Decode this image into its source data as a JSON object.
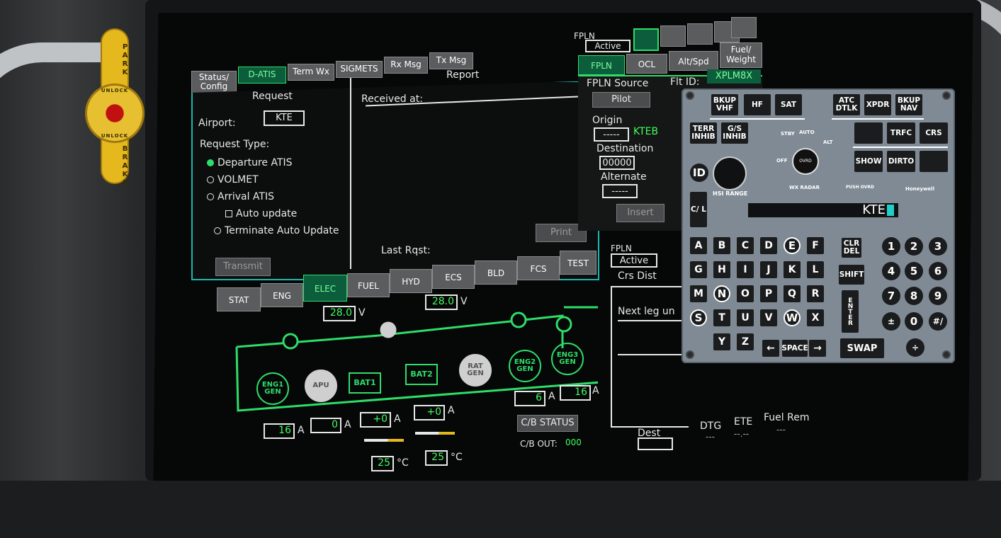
{
  "park_brake": {
    "top": "PARK",
    "unlock1": "UNLOCK",
    "unlock2": "UNLOCK",
    "bottom": "BRAKE"
  },
  "datalink": {
    "tabs": [
      "Status/ Config",
      "D-ATIS",
      "Term Wx",
      "SIGMETS",
      "Rx Msg",
      "Tx Msg"
    ],
    "request_title": "Request",
    "report_title": "Report",
    "airport_label": "Airport:",
    "airport_value": "KTE",
    "request_type_label": "Request Type:",
    "options": [
      "Departure ATIS",
      "VOLMET",
      "Arrival ATIS",
      "Auto update",
      "Terminate Auto Update"
    ],
    "received_label": "Received at:",
    "last_rqst_label": "Last Rqst:",
    "transmit": "Transmit",
    "print": "Print"
  },
  "fpln": {
    "header_label": "FPLN",
    "header_value": "Active",
    "tabs": [
      "FPLN",
      "OCL",
      "Alt/Spd",
      "Fuel/ Weight"
    ],
    "source_label": "FPLN Source",
    "source_value": "Pilot",
    "origin_label": "Origin",
    "origin_box": "-----",
    "origin_value": "KTEB",
    "dest_label": "Destination",
    "dest_box": "00000",
    "alt_label": "Alternate",
    "alt_box": "-----",
    "insert": "Insert",
    "flt_id_label": "Flt ID:",
    "flt_id_value": "XPLM8X"
  },
  "fpln2": {
    "header_label": "FPLN",
    "header_value": "Active",
    "cols": "Crs Dist",
    "next_leg": "Next leg un",
    "dest": "Dest",
    "dtg": "DTG",
    "ete": "ETE",
    "fuel": "Fuel Rem",
    "dtg_val": "---",
    "ete_val": "--.--",
    "fuel_val": "---"
  },
  "synoptic": {
    "tabs": [
      "STAT",
      "ENG",
      "ELEC",
      "FUEL",
      "HYD",
      "ECS",
      "BLD",
      "FCS",
      "TEST"
    ],
    "volt_left": "28.0",
    "volt_right": "28.0",
    "v_unit": "V",
    "sources": [
      "ENG1 GEN",
      "APU",
      "BAT1",
      "BAT2",
      "RAT GEN",
      "ENG2 GEN",
      "ENG3 GEN"
    ],
    "amps": [
      {
        "v": "16",
        "u": "A"
      },
      {
        "v": "0",
        "u": "A"
      },
      {
        "v": "+0",
        "u": "A"
      },
      {
        "v": "+0",
        "u": "A"
      },
      {
        "v": "6",
        "u": "A"
      },
      {
        "v": "16",
        "u": "A"
      }
    ],
    "temps": [
      {
        "v": "25",
        "u": "°C"
      },
      {
        "v": "25",
        "u": "°C"
      }
    ],
    "cb_status": "C/B STATUS",
    "cb_out_label": "C/B OUT:",
    "cb_out_value": "000"
  },
  "keypad": {
    "top": [
      "BKUP VHF",
      "HF",
      "SAT",
      "ATC DTLK",
      "XPDR",
      "BKUP NAV"
    ],
    "row2": [
      "TERR INHIB",
      "G/S INHIB",
      "TRFC",
      "CRS"
    ],
    "row3": [
      "SHOW",
      "DIRTO"
    ],
    "id": "ID",
    "hsi_range": "HSI RANGE",
    "cl": "C/ L",
    "knob": {
      "stby": "STBY",
      "auto": "AUTO",
      "alt": "ALT",
      "off": "OFF",
      "ovrd": "OVRD"
    },
    "wx_radar": "WX RADAR",
    "push_ovrd": "PUSH OVRD",
    "brand": "Honeywell",
    "scratch": "KTE",
    "letters": [
      "A",
      "B",
      "C",
      "D",
      "E",
      "F",
      "G",
      "H",
      "I",
      "J",
      "K",
      "L",
      "M",
      "N",
      "O",
      "P",
      "Q",
      "R",
      "S",
      "T",
      "U",
      "V",
      "W",
      "X",
      "Y",
      "Z"
    ],
    "clr": "CLR DEL",
    "shift": "SHIFT",
    "enter": "ENTER",
    "space": "SPACE",
    "swap": "SWAP",
    "left_arrow": "←",
    "right_arrow": "→",
    "digits": [
      "1",
      "2",
      "3",
      "4",
      "5",
      "6",
      "7",
      "8",
      "9",
      "0"
    ],
    "dot": "±",
    "slash": "#/",
    "divide": "÷"
  }
}
